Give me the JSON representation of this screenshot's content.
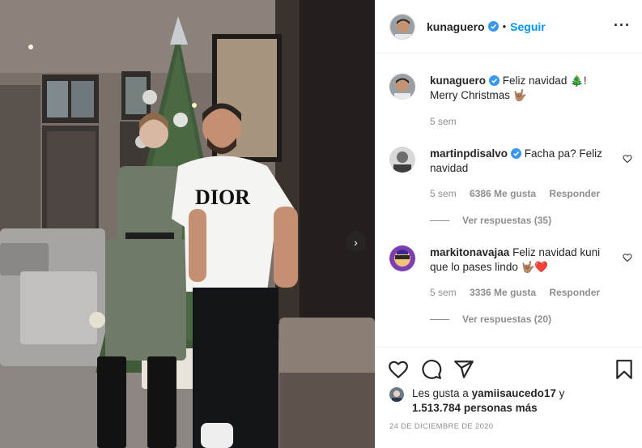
{
  "photo": {
    "description_icon": "next-arrow-icon",
    "shirt_text": "DIOR",
    "next_glyph": "›"
  },
  "header": {
    "username": "kunaguero",
    "separator": "•",
    "follow_label": "Seguir",
    "more_label": "···"
  },
  "caption": {
    "username": "kunaguero",
    "text": "Feliz navidad 🎄! Merry Christmas 🤟🏽",
    "time": "5 sem"
  },
  "comments": [
    {
      "username": "martinpdisalvo",
      "text": "Facha pa? Feliz navidad",
      "time": "5 sem",
      "likes": "6386 Me gusta",
      "reply_label": "Responder",
      "view_replies": "Ver respuestas (35)"
    },
    {
      "username": "markitonavajaa",
      "text": "Feliz navidad kuni que lo pases lindo 🤟🏽❤️",
      "time": "5 sem",
      "likes": "3336 Me gusta",
      "reply_label": "Responder",
      "view_replies": "Ver respuestas (20)"
    }
  ],
  "likes": {
    "prefix": "Les gusta a",
    "user": "yamiisaucedo17",
    "joiner": "y",
    "count": "1.513.784",
    "suffix": "personas más"
  },
  "date": "24 DE DICIEMBRE DE 2020",
  "colors": {
    "link": "#0095f6",
    "verified": "#3897f0",
    "secondary_text": "#8e8e8e",
    "border": "#efefef",
    "heart_red": "#ed4956"
  }
}
